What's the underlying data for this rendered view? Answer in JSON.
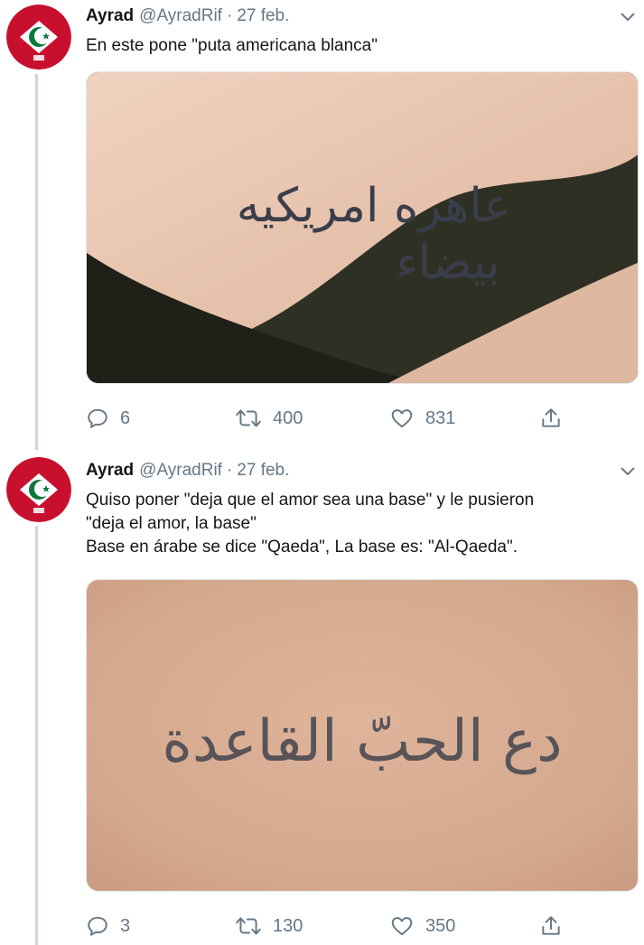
{
  "tweets": [
    {
      "author_name": "Ayrad",
      "author_handle": "@AyradRif",
      "separator": "·",
      "date": "27 feb.",
      "text_lines": [
        "En este pone \"puta americana blanca\""
      ],
      "image": {
        "description_icon": "tattoo-photo",
        "tattoo_text": "عاهره امريكيه بيضاء",
        "skin_color": "#e6c4b0",
        "bg_color": "#2f3024"
      },
      "stats": {
        "replies": "6",
        "retweets": "400",
        "likes": "831"
      }
    },
    {
      "author_name": "Ayrad",
      "author_handle": "@AyradRif",
      "separator": "·",
      "date": "27 feb.",
      "text_lines": [
        "Quiso poner \"deja que el amor sea una base\" y le pusieron",
        "\"deja el amor, la base\"",
        "Base en árabe se dice \"Qaeda\", La base es: \"Al-Qaeda\"."
      ],
      "image": {
        "description_icon": "tattoo-photo",
        "tattoo_text": "دع الحبّ القاعدة",
        "skin_color": "#d7ab91"
      },
      "stats": {
        "replies": "3",
        "retweets": "130",
        "likes": "350"
      }
    }
  ],
  "colors": {
    "secondary_text": "#657786",
    "thread_line": "#ccd6dd",
    "flag_red": "#c8102e",
    "flag_green": "#0a7a3c"
  },
  "icons": {
    "reply": "reply-icon",
    "retweet": "retweet-icon",
    "like": "heart-icon",
    "share": "share-icon",
    "menu": "chevron-down-icon"
  }
}
